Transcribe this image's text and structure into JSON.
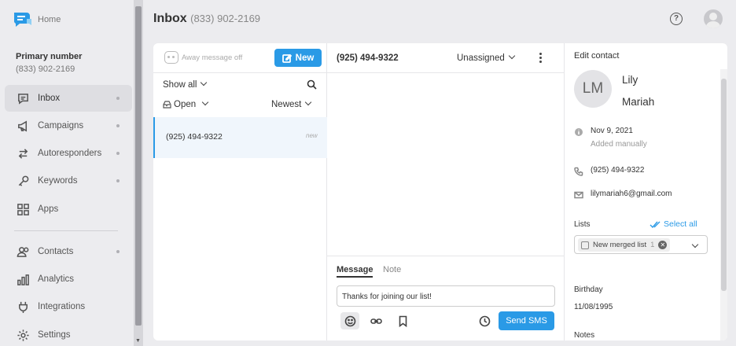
{
  "sidebar": {
    "home_label": "Home",
    "primary_label": "Primary number",
    "primary_number": "(833) 902-2169",
    "items": [
      {
        "label": "Inbox",
        "icon": "chat-bubble-icon",
        "active": true
      },
      {
        "label": "Campaigns",
        "icon": "megaphone-icon"
      },
      {
        "label": "Autoresponders",
        "icon": "swap-arrows-icon"
      },
      {
        "label": "Keywords",
        "icon": "key-icon"
      },
      {
        "label": "Apps",
        "icon": "grid-icon"
      },
      {
        "label": "Contacts",
        "icon": "people-icon"
      },
      {
        "label": "Analytics",
        "icon": "bar-chart-icon"
      },
      {
        "label": "Integrations",
        "icon": "plug-icon"
      },
      {
        "label": "Settings",
        "icon": "gear-icon"
      }
    ]
  },
  "header": {
    "title": "Inbox",
    "phone": "(833) 902-2169"
  },
  "conversations": {
    "away_label": "Away message off",
    "new_button": "New",
    "filter_show": "Show all",
    "filter_status": "Open",
    "sort": "Newest",
    "items": [
      {
        "phone": "(925) 494-9322",
        "badge": "new"
      }
    ]
  },
  "thread": {
    "phone": "(925) 494-9322",
    "assignee": "Unassigned",
    "tab_message": "Message",
    "tab_note": "Note",
    "message_text": "Thanks for joining our list!",
    "send_button": "Send SMS"
  },
  "contact": {
    "heading": "Edit contact",
    "initials": "LM",
    "first_name": "Lily",
    "last_name": "Mariah",
    "created_date": "Nov 9, 2021",
    "created_source": "Added manually",
    "phone": "(925) 494-9322",
    "email": "lilymariah6@gmail.com",
    "lists_label": "Lists",
    "select_all": "Select all",
    "list_chip": "New merged list",
    "list_count": "1",
    "birthday_label": "Birthday",
    "birthday": "11/08/1995",
    "notes_label": "Notes"
  },
  "colors": {
    "accent": "#2a9ae6",
    "background": "#ececef"
  }
}
